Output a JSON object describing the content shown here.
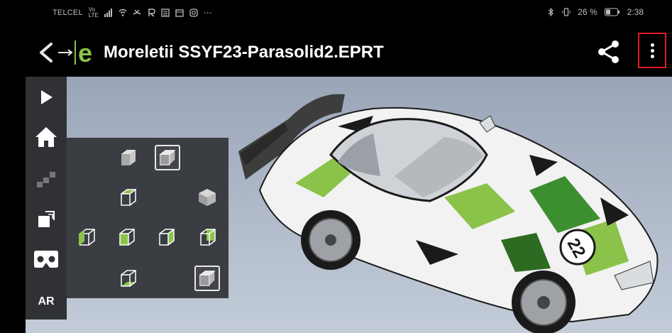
{
  "status_bar": {
    "carrier": "TELCEL",
    "network": "Vo LTE",
    "battery_percent": "26 %",
    "time": "2:38"
  },
  "app_bar": {
    "title": "Moreletii SSYF23-Parasolid2.EPRT",
    "logo_letter": "e"
  },
  "toolbar": {
    "items": [
      "play-icon",
      "home-icon",
      "explode-icon",
      "fit-view-icon",
      "vr-headset-icon",
      "ar-icon"
    ],
    "ar_label": "AR"
  },
  "view_panel": {
    "selected": [
      "iso-top",
      "iso-corner"
    ]
  },
  "colors": {
    "accent_green": "#8bc34a",
    "highlight_red": "#e01b24",
    "toolbar_bg": "#2f3135",
    "panel_bg": "#3a3d42"
  }
}
